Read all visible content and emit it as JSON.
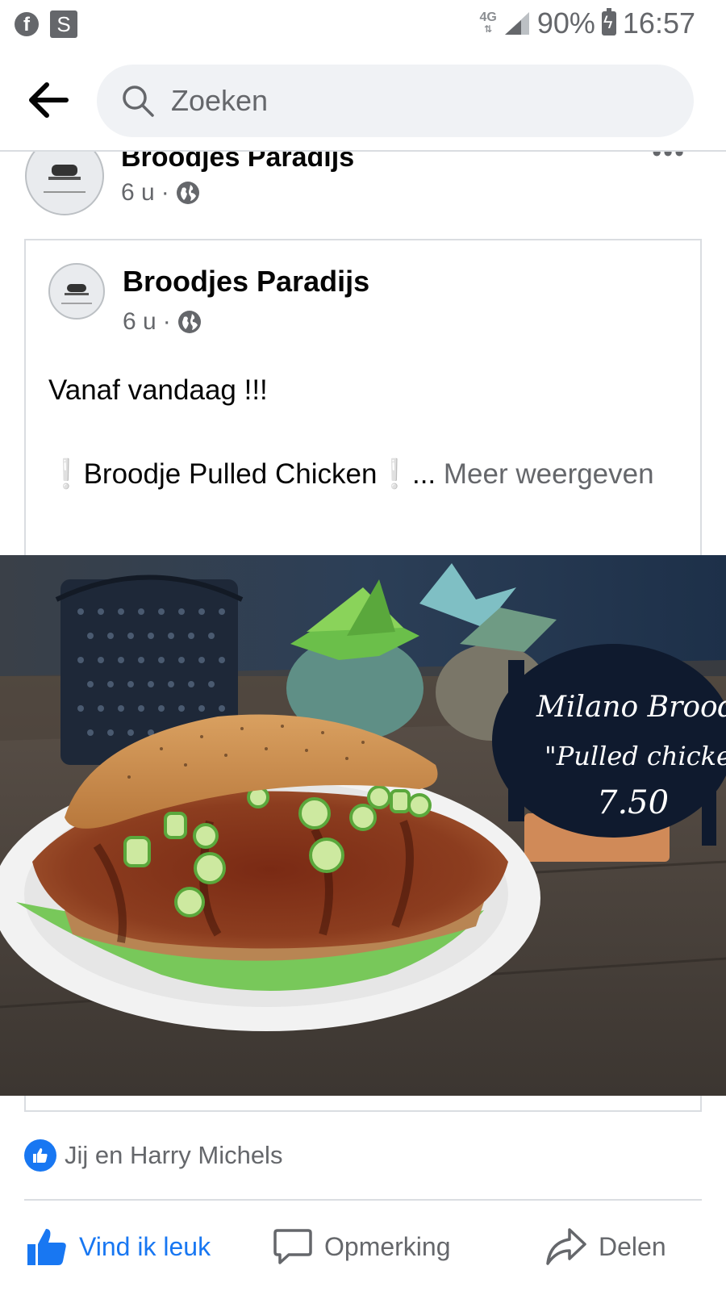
{
  "status_bar": {
    "left_icons": [
      "facebook-icon",
      "s-app-icon"
    ],
    "s_label": "S",
    "network": "4G",
    "battery": "90%",
    "time": "16:57"
  },
  "header": {
    "search_placeholder": "Zoeken"
  },
  "outer_post": {
    "author": "Broodjes Paradijs",
    "time": "6 u",
    "separator": "·"
  },
  "shared_post": {
    "author": "Broodjes Paradijs",
    "time": "6 u",
    "separator": "·",
    "line1": "Vanaf vandaag !!!",
    "line2": "❕Broodje Pulled Chicken❕... ",
    "see_more": "Meer weergeven"
  },
  "photo": {
    "sign_line1": "Milano Broodje",
    "sign_line2": "\"Pulled chicken\"",
    "sign_price": "7.50"
  },
  "reactions": {
    "text": "Jij en Harry Michels"
  },
  "actions": {
    "like": "Vind ik leuk",
    "comment": "Opmerking",
    "share": "Delen"
  },
  "colors": {
    "accent": "#1877f2",
    "muted": "#65676b",
    "divider": "#dadde1"
  }
}
